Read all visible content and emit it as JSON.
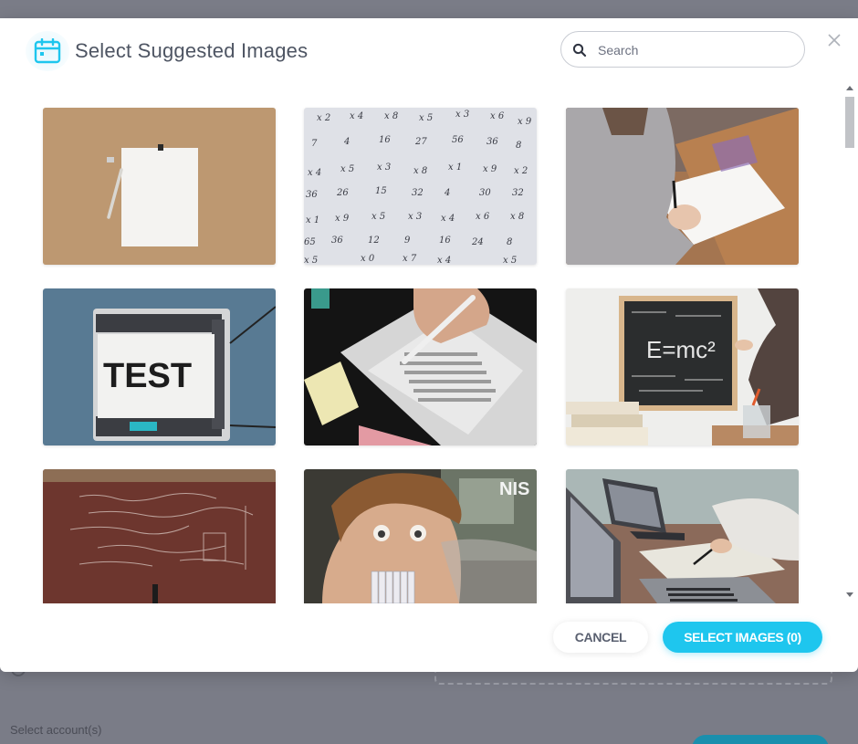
{
  "background": {
    "label": "Select account(s)"
  },
  "modal": {
    "title": "Select Suggested Images",
    "search": {
      "placeholder": "Search",
      "value": ""
    },
    "images": [
      {
        "name": "blank-paper-pencil-image"
      },
      {
        "name": "math-worksheet-image"
      },
      {
        "name": "student-writing-image"
      },
      {
        "name": "test-printer-image",
        "caption": "TEST"
      },
      {
        "name": "answer-sheet-image"
      },
      {
        "name": "chalkboard-emc2-image",
        "caption": "E=mc²"
      },
      {
        "name": "red-chalkboard-image"
      },
      {
        "name": "boy-with-pencils-image",
        "caption": "NIS"
      },
      {
        "name": "laptop-notes-image"
      }
    ],
    "footer": {
      "cancel_label": "CANCEL",
      "select_label": "SELECT IMAGES (0)"
    }
  },
  "colors": {
    "accent": "#1ec6ee",
    "title_text": "#4e5563",
    "overlay": "#7a7c87"
  }
}
